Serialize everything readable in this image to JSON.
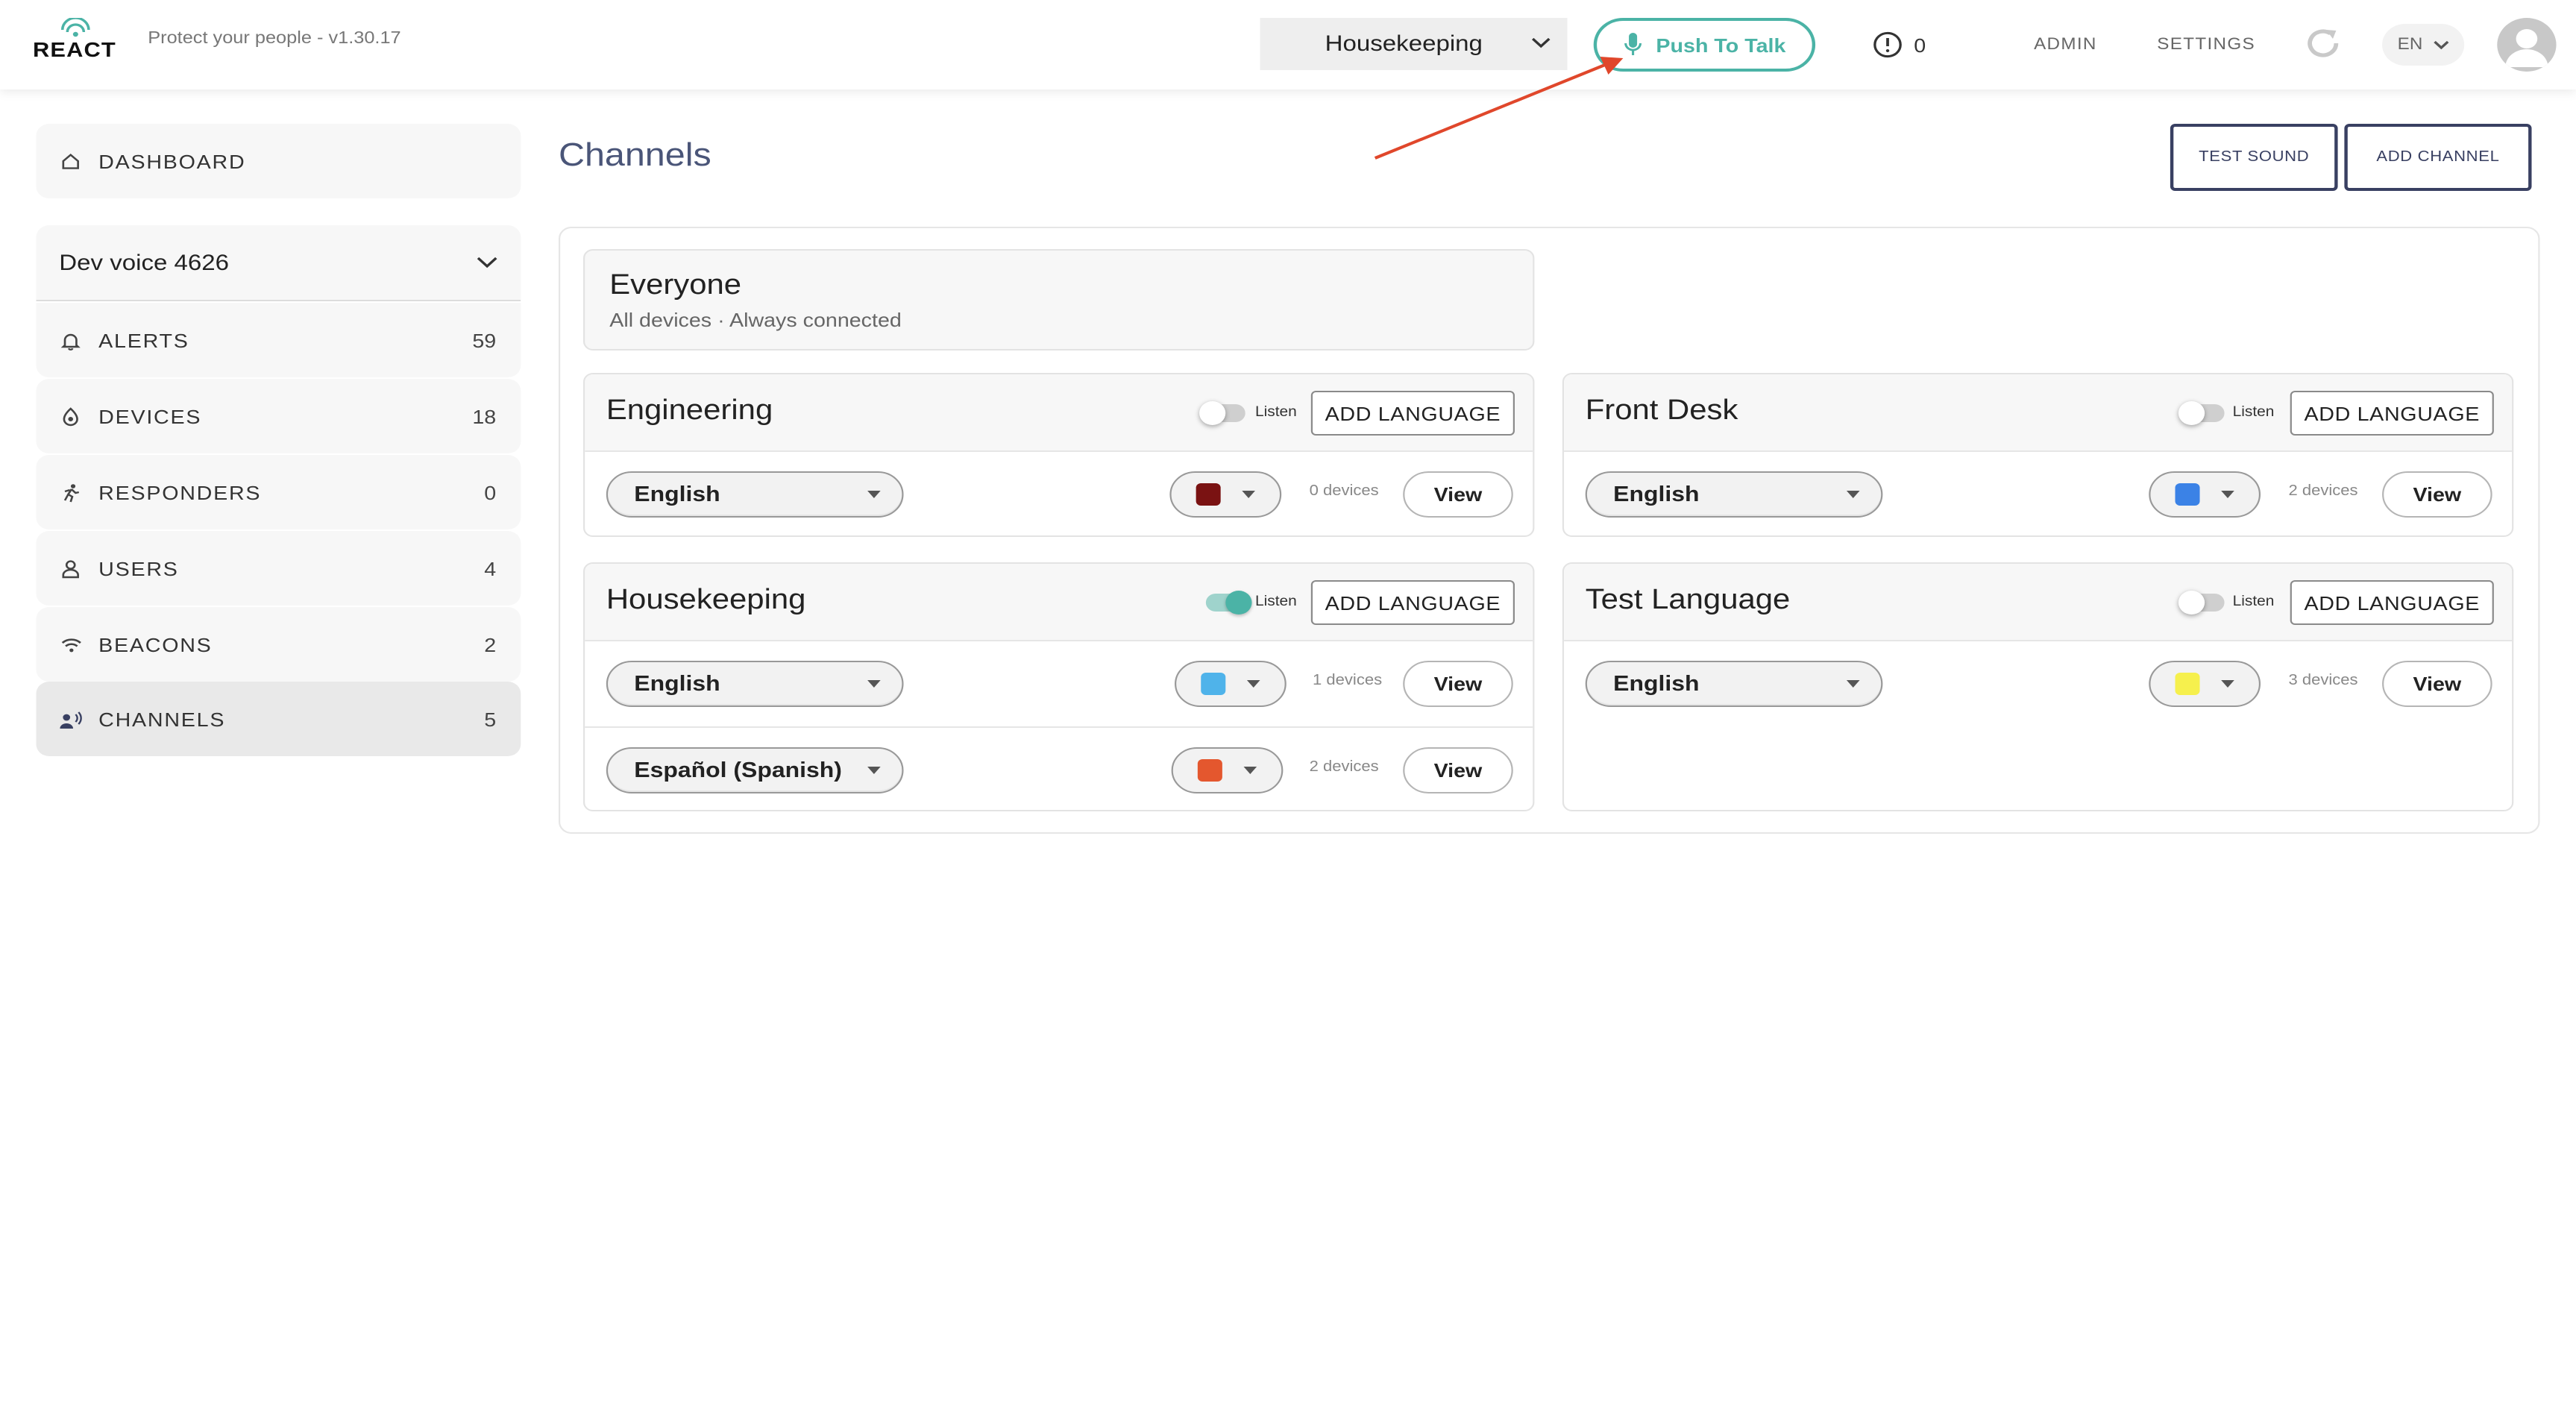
{
  "header": {
    "logo_text": "REACT",
    "tagline": "Protect your people - v1.30.17",
    "channel_select": "Housekeeping",
    "push_to_talk": "Push To Talk",
    "alert_count": "0",
    "admin": "ADMIN",
    "settings": "SETTINGS",
    "language": "EN"
  },
  "sidebar": {
    "dashboard": "DASHBOARD",
    "org": "Dev voice 4626",
    "items": [
      {
        "label": "ALERTS",
        "count": "59"
      },
      {
        "label": "DEVICES",
        "count": "18"
      },
      {
        "label": "RESPONDERS",
        "count": "0"
      },
      {
        "label": "USERS",
        "count": "4"
      },
      {
        "label": "BEACONS",
        "count": "2"
      },
      {
        "label": "CHANNELS",
        "count": "5"
      }
    ]
  },
  "main": {
    "title": "Channels",
    "test_sound": "TEST SOUND",
    "add_channel": "ADD CHANNEL",
    "everyone": {
      "title": "Everyone",
      "subtitle": "All devices · Always connected"
    },
    "listen_label": "Listen",
    "add_language": "ADD LANGUAGE",
    "view_label": "View",
    "channels": [
      {
        "name": "Engineering",
        "listen": false,
        "rows": [
          {
            "language": "English",
            "color": "#7a1212",
            "devices": "0 devices"
          }
        ]
      },
      {
        "name": "Front Desk",
        "listen": false,
        "rows": [
          {
            "language": "English",
            "color": "#3b82e6",
            "devices": "2 devices"
          }
        ]
      },
      {
        "name": "Housekeeping",
        "listen": true,
        "rows": [
          {
            "language": "English",
            "color": "#4fb3ea",
            "devices": "1 devices"
          },
          {
            "language": "Español (Spanish)",
            "color": "#e4572e",
            "devices": "2 devices"
          }
        ]
      },
      {
        "name": "Test Language",
        "listen": false,
        "rows": [
          {
            "language": "English",
            "color": "#f6f04d",
            "devices": "3 devices"
          }
        ]
      }
    ]
  },
  "colors": {
    "accent": "#4bb3a6",
    "navy": "#394062",
    "title": "#4a5578",
    "annotation": "#e0472b"
  }
}
